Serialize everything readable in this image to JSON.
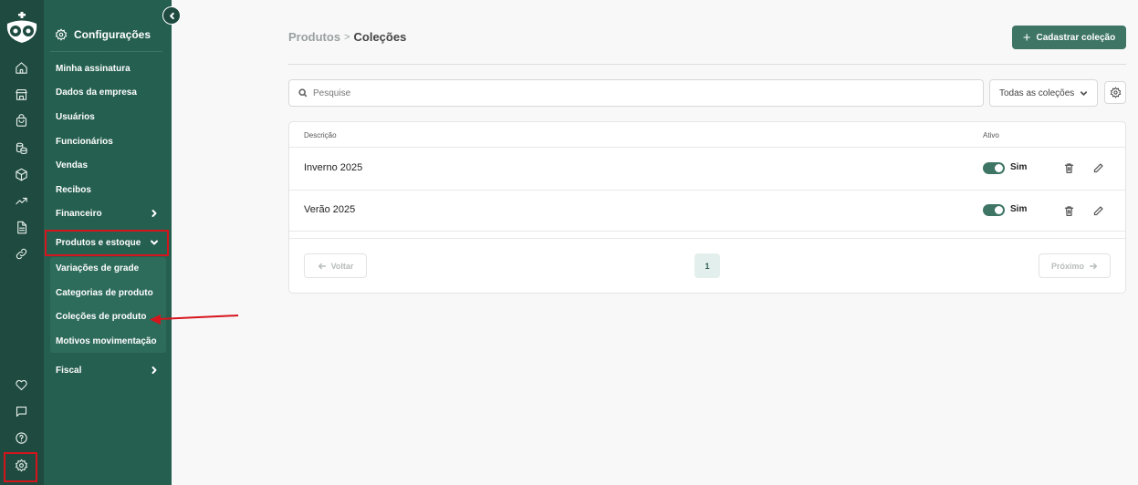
{
  "sidebar_rail": {
    "items": [
      "home-icon",
      "store-icon",
      "shopping-bag-icon",
      "coins-icon",
      "box-icon",
      "trending-up-icon",
      "document-icon",
      "link-icon"
    ],
    "bottom": [
      "heart-icon",
      "chat-icon",
      "help-icon",
      "settings-icon"
    ]
  },
  "settings_menu": {
    "title": "Configurações",
    "items": [
      "Minha assinatura",
      "Dados da empresa",
      "Usuários",
      "Funcionários",
      "Vendas",
      "Recibos"
    ],
    "financeiro": "Financeiro",
    "produtos": "Produtos e estoque",
    "sub_items": [
      "Variações de grade",
      "Categorias de produto",
      "Coleções de produto",
      "Motivos movimentação"
    ],
    "fiscal": "Fiscal"
  },
  "breadcrumb": {
    "parent": "Produtos",
    "separator": ">",
    "current": "Coleções"
  },
  "toolbar": {
    "add_label": "Cadastrar coleção",
    "search_placeholder": "Pesquise",
    "filter_value": "Todas as coleções"
  },
  "table": {
    "headers": {
      "description": "Descrição",
      "active": "Ativo"
    },
    "rows": [
      {
        "description": "Inverno 2025",
        "active_label": "Sim"
      },
      {
        "description": "Verão 2025",
        "active_label": "Sim"
      }
    ]
  },
  "pagination": {
    "prev": "Voltar",
    "page": "1",
    "next": "Próximo"
  },
  "colors": {
    "rail": "#1e4a3f",
    "menu": "#255f50",
    "accent": "#3e7565",
    "highlight": "#d6141c"
  }
}
